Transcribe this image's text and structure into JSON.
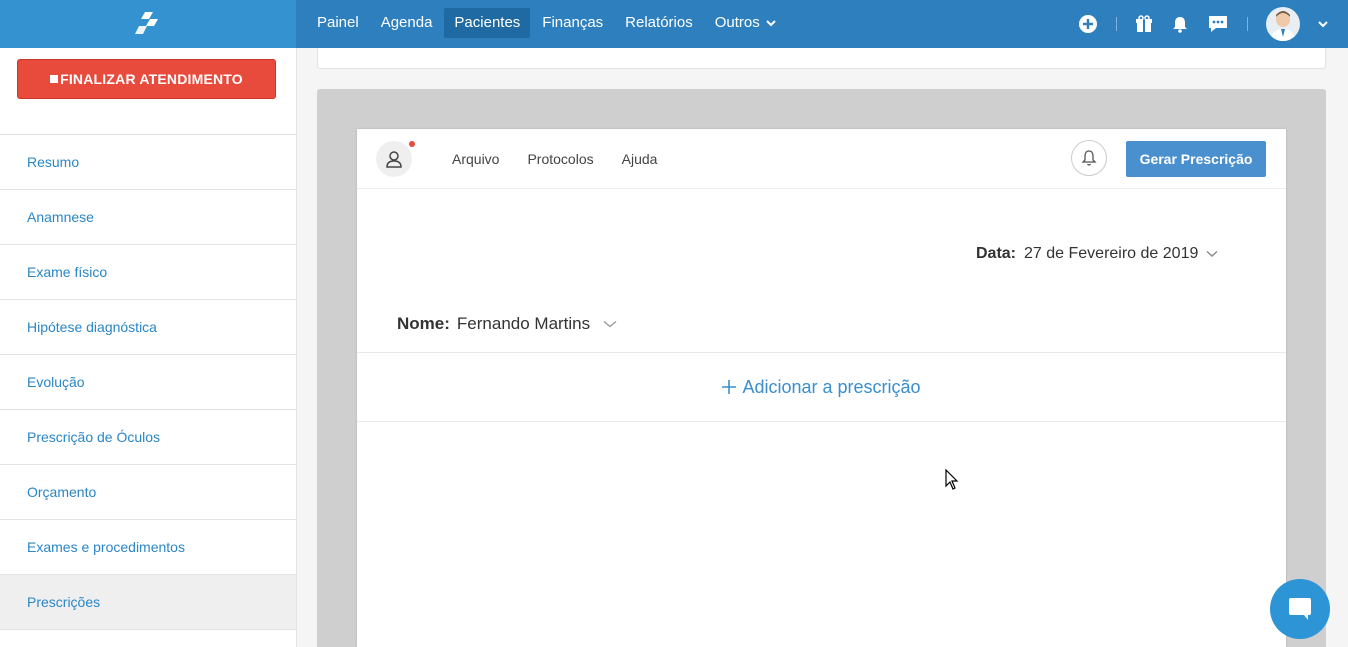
{
  "topbar": {
    "nav": [
      "Painel",
      "Agenda",
      "Pacientes",
      "Finanças",
      "Relatórios",
      "Outros"
    ],
    "active": "Pacientes",
    "icons": [
      "plus-circle-icon",
      "gift-icon",
      "bell-icon",
      "chat-icon",
      "avatar",
      "chevron-down-icon"
    ]
  },
  "sidebar": {
    "finalize_label": "FINALIZAR ATENDIMENTO",
    "items": [
      {
        "label": "Resumo"
      },
      {
        "label": "Anamnese"
      },
      {
        "label": "Exame físico"
      },
      {
        "label": "Hipótese diagnóstica"
      },
      {
        "label": "Evolução"
      },
      {
        "label": "Prescrição de Óculos"
      },
      {
        "label": "Orçamento"
      },
      {
        "label": "Exames e procedimentos"
      },
      {
        "label": "Prescrições"
      }
    ],
    "active_item": "Prescrições"
  },
  "document": {
    "menu": [
      "Arquivo",
      "Protocolos",
      "Ajuda"
    ],
    "generate_label": "Gerar Prescrição",
    "date_label": "Data:",
    "date_value": "27 de Fevereiro de 2019",
    "name_label": "Nome:",
    "name_value": "Fernando Martins",
    "add_label": "Adicionar a prescrição"
  },
  "colors": {
    "topbar": "#2e7fbd",
    "accent": "#2a86c6",
    "danger": "#e84b3c"
  }
}
